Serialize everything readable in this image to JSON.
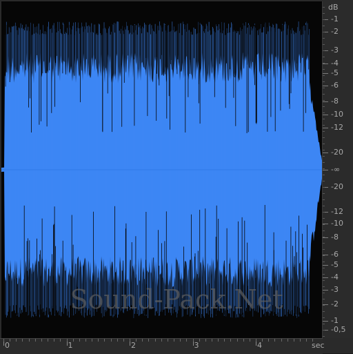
{
  "colors": {
    "waveform_fill": "#3d86f4",
    "waveform_dark": "#2a6fd8",
    "background": "#060606",
    "ruler_bg": "#2b2b2b",
    "ruler_text": "#a9a9a9"
  },
  "db_ruler": {
    "unit": "dB",
    "labels": [
      "-1",
      "-2",
      "-3",
      "-4",
      "-5",
      "-6",
      "-8",
      "-10",
      "-12",
      "-20",
      "-∞",
      "-20",
      "-12",
      "-10",
      "-8",
      "-6",
      "-5",
      "-4",
      "-3",
      "-2",
      "-1",
      "-0,5"
    ]
  },
  "time_ruler": {
    "labels": [
      "0",
      "1",
      "2",
      "3",
      "4"
    ],
    "unit": "sec"
  },
  "watermark": "Sound-Pack.Net"
}
